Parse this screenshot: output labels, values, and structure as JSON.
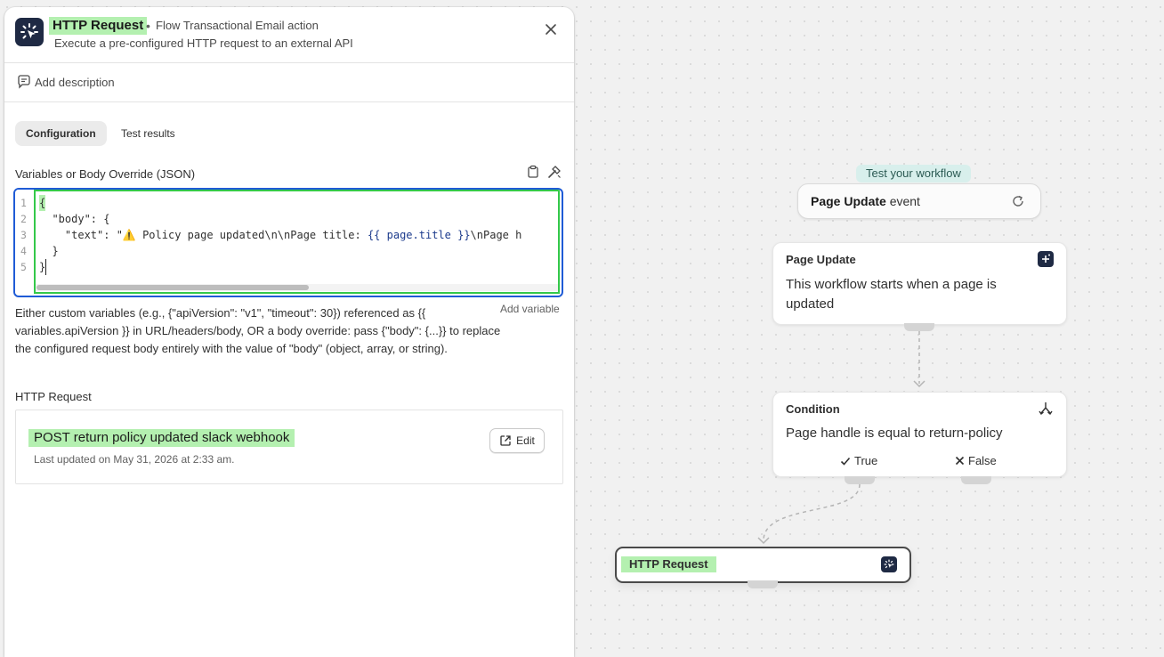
{
  "panel": {
    "title": "HTTP Request",
    "separator": "•",
    "source": "Flow Transactional Email action",
    "subtitle": "Execute a pre-configured HTTP request to an external API",
    "add_description": "Add description",
    "tabs": [
      {
        "label": "Configuration",
        "active": true
      },
      {
        "label": "Test results",
        "active": false
      }
    ],
    "field_label": "Variables or Body Override (JSON)",
    "editor": {
      "line_numbers": [
        "1",
        "2",
        "3",
        "4",
        "5"
      ],
      "line1": "{",
      "line2": "  \"body\": {",
      "line3_prefix": "    \"text\": \"⚠️ Policy page updated\\n\\nPage title: ",
      "line3_var": "{{ page.title }}",
      "line3_suffix": "\\nPage h",
      "line4": "  }",
      "line5": "}"
    },
    "add_variable": "Add variable",
    "help_text": "Either custom variables (e.g., {\"apiVersion\": \"v1\", \"timeout\": 30}) referenced as {{ variables.apiVersion }} in URL/headers/body, OR a body override: pass {\"body\": {...}} to replace the configured request body entirely with the value of \"body\" (object, array, or string).",
    "http_section_label": "HTTP Request",
    "http_card": {
      "title": "POST return policy updated slack webhook",
      "updated": "Last updated on May 31, 2026 at 2:33 am.",
      "edit_label": "Edit"
    }
  },
  "canvas": {
    "test_badge": "Test your workflow",
    "trigger_bold": "Page Update",
    "trigger_rest": " event",
    "nodes": {
      "page_update": {
        "title": "Page Update",
        "body": "This workflow starts when a page is updated"
      },
      "condition": {
        "title": "Condition",
        "body": "Page handle is equal to return-policy",
        "true_label": "True",
        "false_label": "False"
      },
      "http_request": {
        "title": "HTTP Request"
      }
    }
  },
  "colors": {
    "accent_blue": "#1f5bd6",
    "highlight_green": "#b4f0b0",
    "app_icon_bg": "#1f2a44",
    "badge_bg": "#d8efec"
  }
}
